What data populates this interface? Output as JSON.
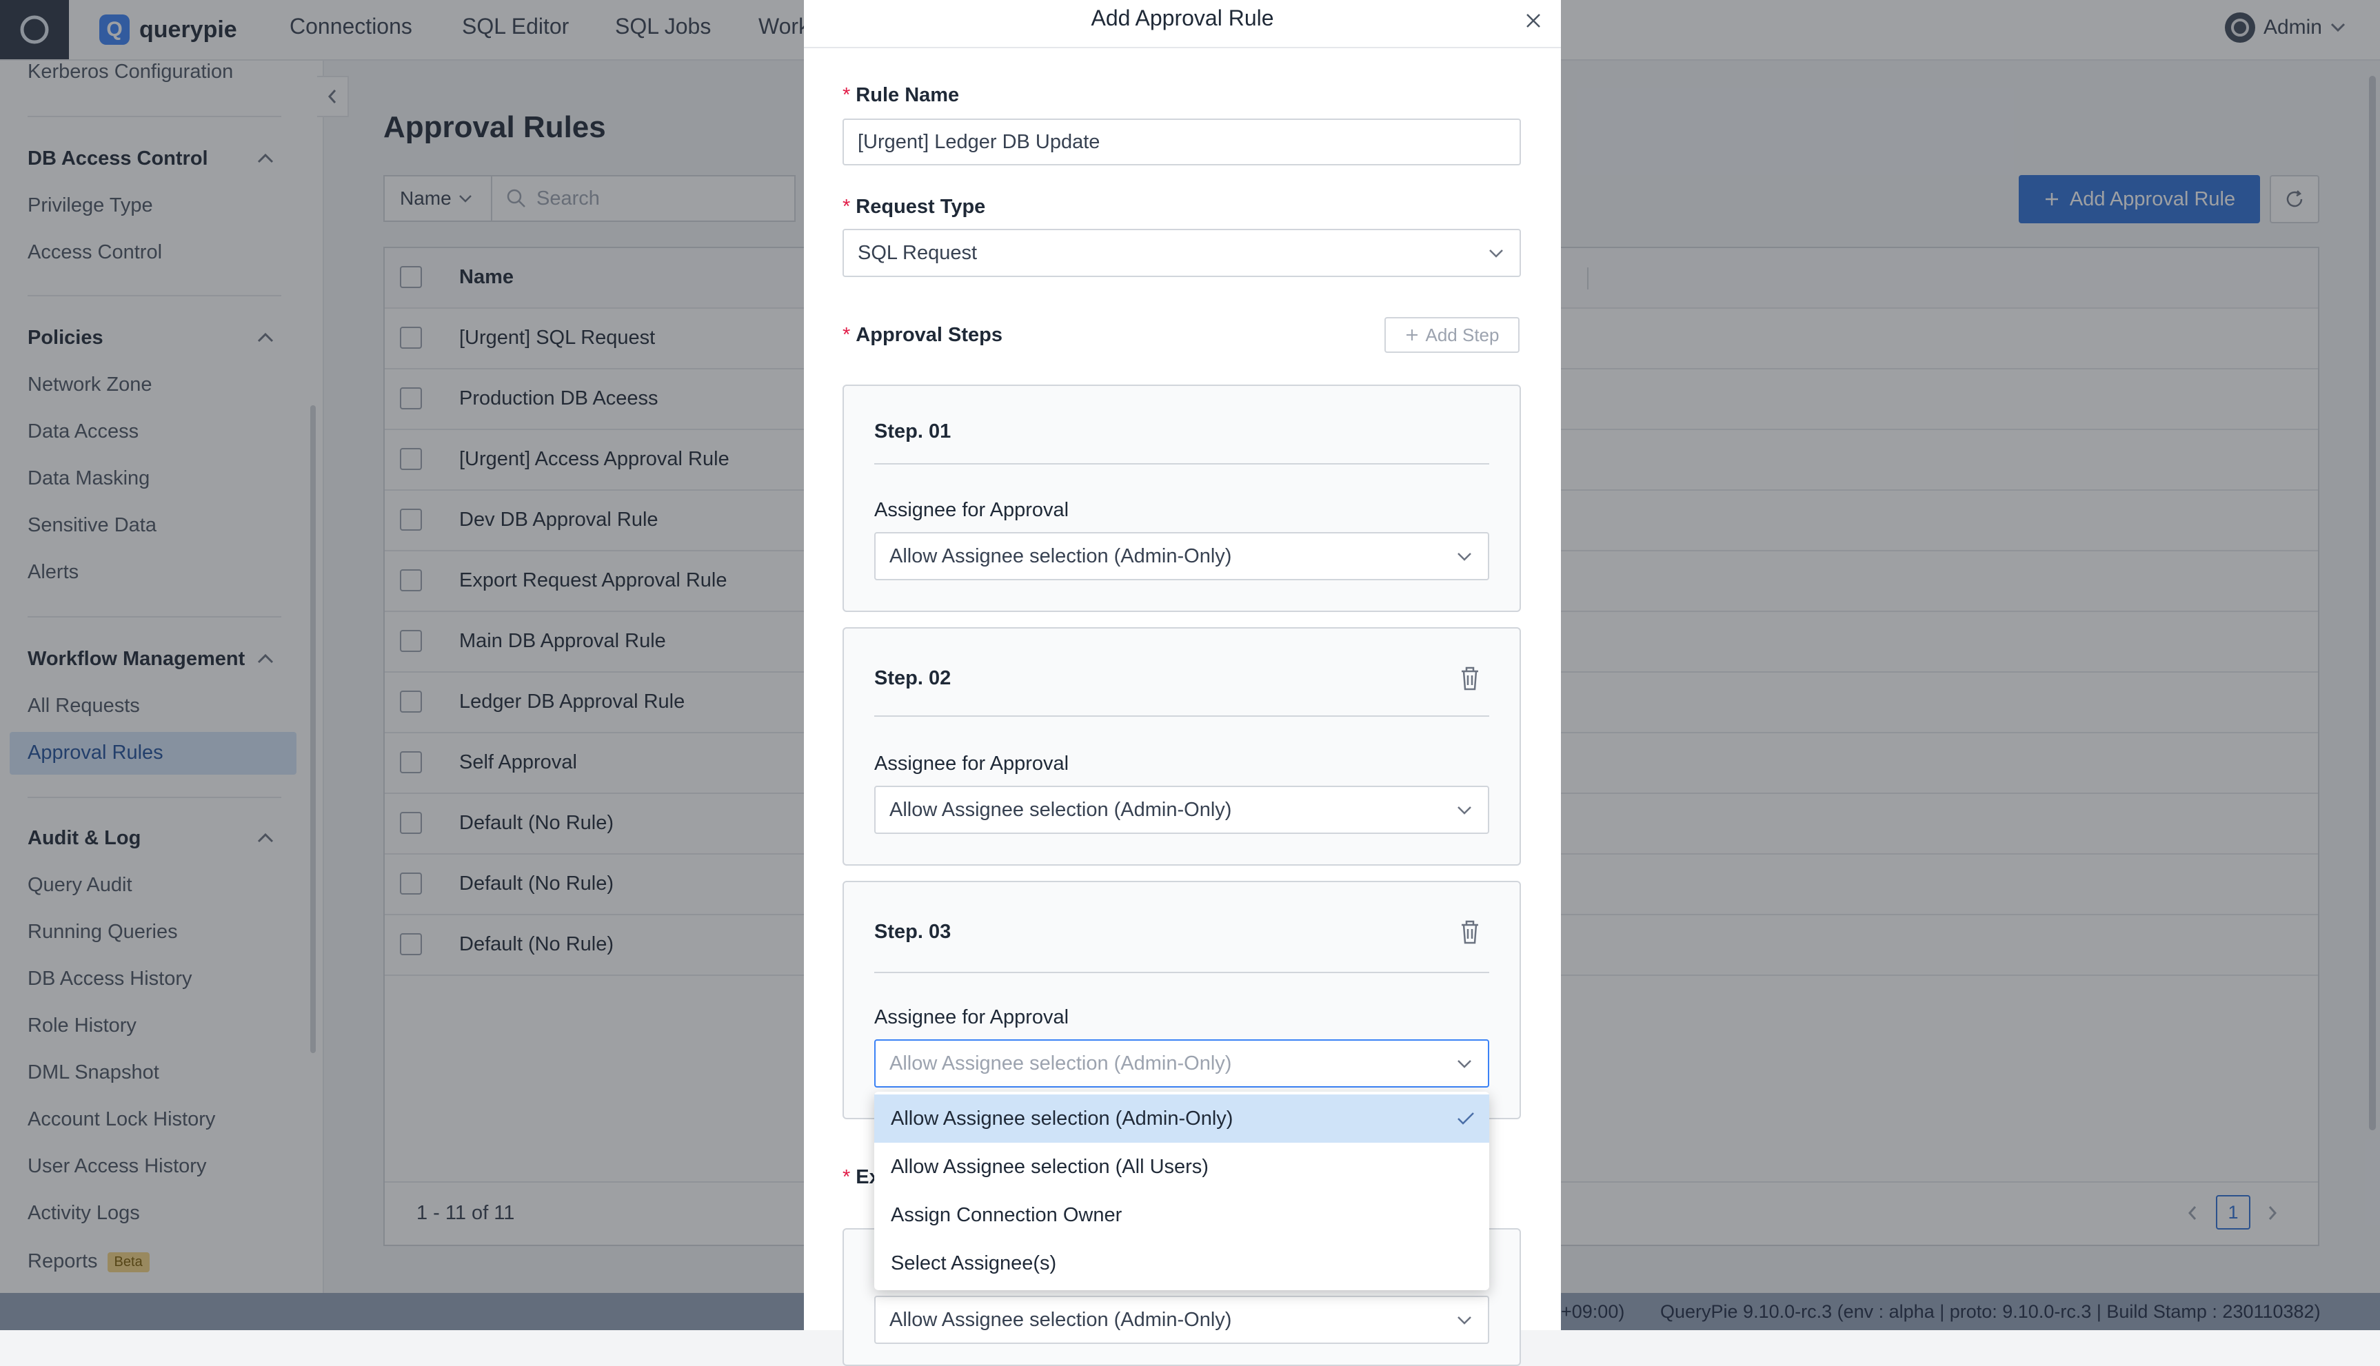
{
  "app": {
    "brand": "querypie"
  },
  "topnav": {
    "items": [
      "Connections",
      "SQL Editor",
      "SQL Jobs",
      "Work"
    ],
    "user": "Admin"
  },
  "sidebar": {
    "top_item": "Kerberos Configuration",
    "sections": [
      {
        "title": "DB Access Control",
        "items": [
          "Privilege Type",
          "Access Control"
        ]
      },
      {
        "title": "Policies",
        "items": [
          "Network Zone",
          "Data Access",
          "Data Masking",
          "Sensitive Data",
          "Alerts"
        ]
      },
      {
        "title": "Workflow Management",
        "items": [
          "All Requests",
          "Approval Rules"
        ]
      },
      {
        "title": "Audit & Log",
        "items": [
          "Query Audit",
          "Running Queries",
          "DB Access History",
          "Role History",
          "DML Snapshot",
          "Account Lock History",
          "User Access History",
          "Activity Logs",
          "Reports"
        ]
      }
    ],
    "active_item": "Approval Rules",
    "reports_badge": "Beta"
  },
  "main": {
    "title": "Approval Rules",
    "filter_field": "Name",
    "search_placeholder": "Search",
    "add_button": "Add Approval Rule",
    "table": {
      "column_name": "Name",
      "rows": [
        "[Urgent] SQL Request",
        "Production DB Aceess",
        "[Urgent] Access Approval Rule",
        "Dev DB Approval Rule",
        "Export Request Approval Rule",
        "Main DB Approval Rule",
        "Ledger DB Approval Rule",
        "Self Approval",
        "Default (No Rule)",
        "Default (No Rule)",
        "Default (No Rule)"
      ],
      "pagination_summary": "1 - 11 of 11",
      "current_page": "1"
    }
  },
  "statusbar": {
    "timezone_fragment": "+09:00)",
    "version": "QueryPie 9.10.0-rc.3 (env : alpha | proto: 9.10.0-rc.3 | Build Stamp : 230110382)"
  },
  "modal": {
    "title": "Add Approval Rule",
    "rule_name_label": "Rule Name",
    "rule_name_value": "[Urgent] Ledger DB Update",
    "request_type_label": "Request Type",
    "request_type_value": "SQL Request",
    "approval_steps_label": "Approval Steps",
    "add_step_label": "Add Step",
    "steps": [
      {
        "title": "Step. 01",
        "assignee_label": "Assignee for Approval",
        "assignee_value": "Allow Assignee selection (Admin-Only)"
      },
      {
        "title": "Step. 02",
        "assignee_label": "Assignee for Approval",
        "assignee_value": "Allow Assignee selection (Admin-Only)"
      },
      {
        "title": "Step. 03",
        "assignee_label": "Assignee for Approval",
        "assignee_value": "Allow Assignee selection (Admin-Only)"
      }
    ],
    "next_section_label_fragment": "Ex",
    "next_field_value": "Allow Assignee selection (Admin-Only)",
    "dropdown_options": [
      "Allow Assignee selection (Admin-Only)",
      "Allow Assignee selection (All Users)",
      "Assign Connection Owner",
      "Select Assignee(s)"
    ],
    "dropdown_selected_index": 0
  },
  "colors": {
    "primary": "#2f6fd6",
    "active_bg": "#d3e3f7",
    "required": "#e11d48",
    "dropdown_selected": "#cfe3f8"
  },
  "icons": [
    "app-logo-icon",
    "brand-q-icon",
    "avatar-icon",
    "chevron-down-icon",
    "chevron-up-icon",
    "chevron-left-icon",
    "chevron-right-icon",
    "search-icon",
    "plus-icon",
    "refresh-icon",
    "close-icon",
    "trash-icon",
    "check-icon"
  ]
}
